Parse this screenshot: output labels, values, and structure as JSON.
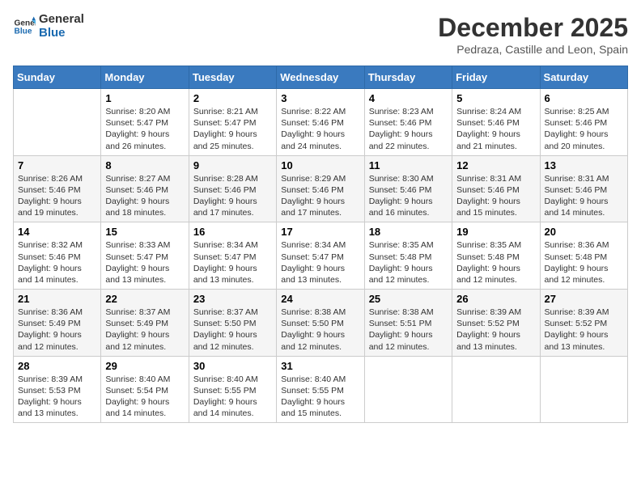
{
  "header": {
    "logo_line1": "General",
    "logo_line2": "Blue",
    "month": "December 2025",
    "location": "Pedraza, Castille and Leon, Spain"
  },
  "weekdays": [
    "Sunday",
    "Monday",
    "Tuesday",
    "Wednesday",
    "Thursday",
    "Friday",
    "Saturday"
  ],
  "weeks": [
    [
      {
        "day": "",
        "text": ""
      },
      {
        "day": "1",
        "text": "Sunrise: 8:20 AM\nSunset: 5:47 PM\nDaylight: 9 hours\nand 26 minutes."
      },
      {
        "day": "2",
        "text": "Sunrise: 8:21 AM\nSunset: 5:47 PM\nDaylight: 9 hours\nand 25 minutes."
      },
      {
        "day": "3",
        "text": "Sunrise: 8:22 AM\nSunset: 5:46 PM\nDaylight: 9 hours\nand 24 minutes."
      },
      {
        "day": "4",
        "text": "Sunrise: 8:23 AM\nSunset: 5:46 PM\nDaylight: 9 hours\nand 22 minutes."
      },
      {
        "day": "5",
        "text": "Sunrise: 8:24 AM\nSunset: 5:46 PM\nDaylight: 9 hours\nand 21 minutes."
      },
      {
        "day": "6",
        "text": "Sunrise: 8:25 AM\nSunset: 5:46 PM\nDaylight: 9 hours\nand 20 minutes."
      }
    ],
    [
      {
        "day": "7",
        "text": "Sunrise: 8:26 AM\nSunset: 5:46 PM\nDaylight: 9 hours\nand 19 minutes."
      },
      {
        "day": "8",
        "text": "Sunrise: 8:27 AM\nSunset: 5:46 PM\nDaylight: 9 hours\nand 18 minutes."
      },
      {
        "day": "9",
        "text": "Sunrise: 8:28 AM\nSunset: 5:46 PM\nDaylight: 9 hours\nand 17 minutes."
      },
      {
        "day": "10",
        "text": "Sunrise: 8:29 AM\nSunset: 5:46 PM\nDaylight: 9 hours\nand 17 minutes."
      },
      {
        "day": "11",
        "text": "Sunrise: 8:30 AM\nSunset: 5:46 PM\nDaylight: 9 hours\nand 16 minutes."
      },
      {
        "day": "12",
        "text": "Sunrise: 8:31 AM\nSunset: 5:46 PM\nDaylight: 9 hours\nand 15 minutes."
      },
      {
        "day": "13",
        "text": "Sunrise: 8:31 AM\nSunset: 5:46 PM\nDaylight: 9 hours\nand 14 minutes."
      }
    ],
    [
      {
        "day": "14",
        "text": "Sunrise: 8:32 AM\nSunset: 5:46 PM\nDaylight: 9 hours\nand 14 minutes."
      },
      {
        "day": "15",
        "text": "Sunrise: 8:33 AM\nSunset: 5:47 PM\nDaylight: 9 hours\nand 13 minutes."
      },
      {
        "day": "16",
        "text": "Sunrise: 8:34 AM\nSunset: 5:47 PM\nDaylight: 9 hours\nand 13 minutes."
      },
      {
        "day": "17",
        "text": "Sunrise: 8:34 AM\nSunset: 5:47 PM\nDaylight: 9 hours\nand 13 minutes."
      },
      {
        "day": "18",
        "text": "Sunrise: 8:35 AM\nSunset: 5:48 PM\nDaylight: 9 hours\nand 12 minutes."
      },
      {
        "day": "19",
        "text": "Sunrise: 8:35 AM\nSunset: 5:48 PM\nDaylight: 9 hours\nand 12 minutes."
      },
      {
        "day": "20",
        "text": "Sunrise: 8:36 AM\nSunset: 5:48 PM\nDaylight: 9 hours\nand 12 minutes."
      }
    ],
    [
      {
        "day": "21",
        "text": "Sunrise: 8:36 AM\nSunset: 5:49 PM\nDaylight: 9 hours\nand 12 minutes."
      },
      {
        "day": "22",
        "text": "Sunrise: 8:37 AM\nSunset: 5:49 PM\nDaylight: 9 hours\nand 12 minutes."
      },
      {
        "day": "23",
        "text": "Sunrise: 8:37 AM\nSunset: 5:50 PM\nDaylight: 9 hours\nand 12 minutes."
      },
      {
        "day": "24",
        "text": "Sunrise: 8:38 AM\nSunset: 5:50 PM\nDaylight: 9 hours\nand 12 minutes."
      },
      {
        "day": "25",
        "text": "Sunrise: 8:38 AM\nSunset: 5:51 PM\nDaylight: 9 hours\nand 12 minutes."
      },
      {
        "day": "26",
        "text": "Sunrise: 8:39 AM\nSunset: 5:52 PM\nDaylight: 9 hours\nand 13 minutes."
      },
      {
        "day": "27",
        "text": "Sunrise: 8:39 AM\nSunset: 5:52 PM\nDaylight: 9 hours\nand 13 minutes."
      }
    ],
    [
      {
        "day": "28",
        "text": "Sunrise: 8:39 AM\nSunset: 5:53 PM\nDaylight: 9 hours\nand 13 minutes."
      },
      {
        "day": "29",
        "text": "Sunrise: 8:40 AM\nSunset: 5:54 PM\nDaylight: 9 hours\nand 14 minutes."
      },
      {
        "day": "30",
        "text": "Sunrise: 8:40 AM\nSunset: 5:55 PM\nDaylight: 9 hours\nand 14 minutes."
      },
      {
        "day": "31",
        "text": "Sunrise: 8:40 AM\nSunset: 5:55 PM\nDaylight: 9 hours\nand 15 minutes."
      },
      {
        "day": "",
        "text": ""
      },
      {
        "day": "",
        "text": ""
      },
      {
        "day": "",
        "text": ""
      }
    ]
  ]
}
